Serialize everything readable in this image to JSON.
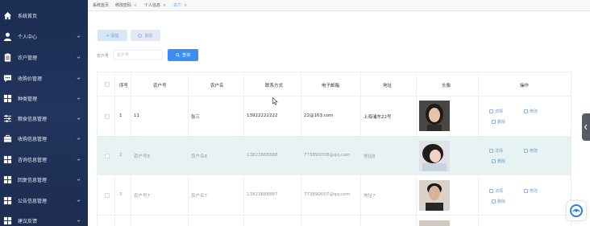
{
  "sidebar": {
    "items": [
      {
        "label": "系统首页",
        "icon": "home-icon",
        "has_chevron": false
      },
      {
        "label": "个人中心",
        "icon": "user-icon",
        "has_chevron": true
      },
      {
        "label": "农户管理",
        "icon": "clipboard-icon",
        "has_chevron": true
      },
      {
        "label": "收购价管理",
        "icon": "chat-icon",
        "has_chevron": true
      },
      {
        "label": "种类管理",
        "icon": "grid-icon",
        "has_chevron": true
      },
      {
        "label": "粮食信息管理",
        "icon": "sliders-icon",
        "has_chevron": true
      },
      {
        "label": "收购信息管理",
        "icon": "briefcase-icon",
        "has_chevron": true
      },
      {
        "label": "咨询信息管理",
        "icon": "grid-icon",
        "has_chevron": true
      },
      {
        "label": "回复信息管理",
        "icon": "grid-icon",
        "has_chevron": true
      },
      {
        "label": "公告信息管理",
        "icon": "grid-icon",
        "has_chevron": true
      },
      {
        "label": "建议反馈",
        "icon": "grid-icon",
        "has_chevron": true
      }
    ]
  },
  "tabs": [
    {
      "label": "系统首页",
      "closable": false,
      "active": false
    },
    {
      "label": "修改密码",
      "closable": true,
      "active": false
    },
    {
      "label": "个人信息",
      "closable": true,
      "active": false
    },
    {
      "label": "农户",
      "closable": true,
      "active": true
    }
  ],
  "toolbar": {
    "add_label": "+ 添加",
    "delete_label": "删除"
  },
  "search": {
    "label": "农户号",
    "placeholder": "农户号",
    "button_label": "查询"
  },
  "table": {
    "headers": [
      "序号",
      "农户号",
      "农户名",
      "联系方式",
      "电子邮箱",
      "地址",
      "头像",
      "操作"
    ],
    "rows": [
      {
        "index": "1",
        "farmer_no": "11",
        "name": "张三",
        "phone": "13922222222",
        "email": "22@163.com",
        "address": "上海浦东22号",
        "avatar": "female-portrait"
      },
      {
        "index": "2",
        "farmer_no": "农户号8",
        "name": "农户名8",
        "phone": "13823888888",
        "email": "773890008@qq.com",
        "address": "地址8",
        "avatar": "girl-portrait"
      },
      {
        "index": "3",
        "farmer_no": "农户号7",
        "name": "农户名7",
        "phone": "13823888887",
        "email": "773890007@qq.com",
        "address": "地址7",
        "avatar": "male-portrait"
      }
    ],
    "actions": {
      "detail": "详情",
      "edit": "修改",
      "delete": "删除"
    }
  },
  "colors": {
    "sidebar_bg": "#1b2d52",
    "primary": "#3b8ff0",
    "row_highlight": "#e7f3f3",
    "link": "#6a9ad6"
  }
}
